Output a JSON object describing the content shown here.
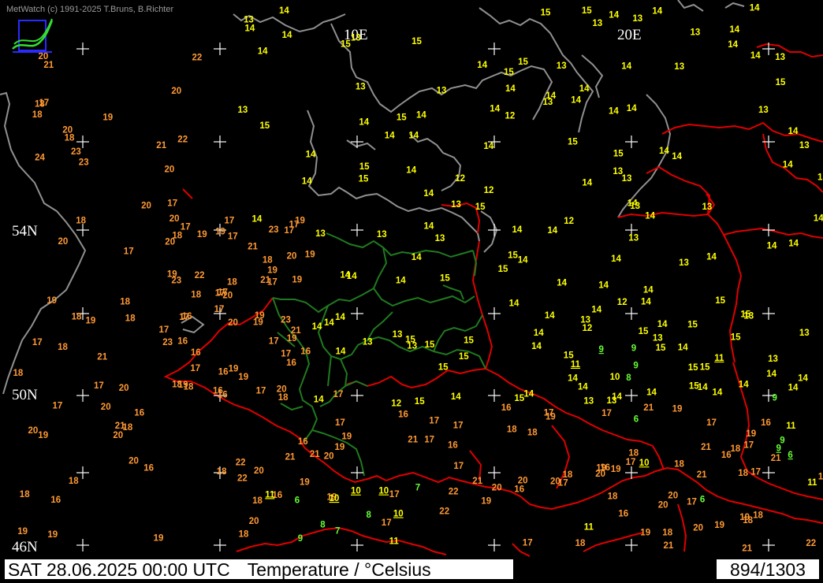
{
  "header": {
    "credit": "MetWatch  (c) 1991-2025 T.Bruns, B.Richter"
  },
  "logo": {
    "icon": "metwatch-logo-icon"
  },
  "footer": {
    "datetime": "SAT 28.06.2025 00:00 UTC",
    "parameter": "Temperature / °Celsius",
    "counter": "894/1303"
  },
  "map": {
    "lat_labels": [
      "54N",
      "50N",
      "46N"
    ],
    "lon_labels": [
      "10E",
      "20E"
    ],
    "colors": {
      "background": "#000000",
      "coast": "#909090",
      "border": "#e00000",
      "state": "#1f7a1f",
      "temp_le9": "#66ff33",
      "temp_10_15": "#ffff00",
      "temp_16_plus": "#ff9933",
      "grid": "#ffffff"
    },
    "stations": [
      [
        15,
        "15"
      ],
      [
        15,
        "15"
      ],
      [
        16,
        "16"
      ],
      [
        16,
        "16"
      ],
      [
        16,
        "16"
      ],
      [
        15,
        "15"
      ],
      [
        16,
        "16"
      ],
      [
        17,
        "17"
      ],
      [
        16,
        "16"
      ],
      [
        16,
        "16"
      ],
      [
        18,
        "18"
      ],
      [
        17,
        "17"
      ],
      [
        16,
        "16"
      ],
      [
        17,
        "17"
      ],
      [
        17,
        "17"
      ],
      [
        17,
        "17"
      ],
      [
        16,
        "16"
      ],
      [
        18,
        "18"
      ],
      [
        17,
        "17"
      ],
      [
        9,
        "9"
      ],
      [
        16,
        "16"
      ],
      [
        18,
        "18"
      ],
      [
        17,
        "17"
      ],
      [
        19,
        "19"
      ],
      [
        17,
        "17"
      ],
      [
        18,
        "18"
      ],
      [
        16,
        "16"
      ],
      [
        20,
        "20"
      ],
      [
        19,
        "19"
      ],
      [
        21,
        "21"
      ],
      [
        21,
        "21"
      ],
      [
        19,
        "19"
      ],
      [
        18,
        "18"
      ],
      [
        20,
        "20"
      ],
      [
        22,
        "22"
      ],
      [
        21,
        "21"
      ],
      [
        20,
        "20"
      ],
      [
        19,
        "19"
      ],
      [
        18,
        "18"
      ],
      [
        21,
        "21"
      ],
      [
        21,
        "21"
      ],
      [
        20,
        "20"
      ],
      [
        19,
        "19"
      ],
      [
        17,
        "17"
      ],
      [
        18,
        "18"
      ],
      [
        20,
        "20"
      ],
      [
        21,
        "21"
      ],
      [
        22,
        "22"
      ],
      [
        21,
        "21"
      ],
      [
        20,
        "20"
      ],
      [
        18,
        "18"
      ],
      [
        19,
        "19"
      ],
      [
        17,
        "17"
      ],
      [
        18,
        "18"
      ],
      [
        17,
        "17"
      ],
      [
        19,
        "19"
      ],
      [
        20,
        "20"
      ],
      [
        18,
        "18"
      ],
      [
        19,
        "19"
      ],
      [
        18,
        "18"
      ],
      [
        19,
        "19"
      ],
      [
        20,
        "20"
      ],
      [
        18,
        "18"
      ],
      [
        16,
        "16"
      ],
      [
        17,
        "17"
      ],
      [
        18,
        "18"
      ],
      [
        19,
        "19"
      ],
      [
        20,
        "20"
      ],
      [
        19,
        "19"
      ],
      [
        18,
        "18"
      ],
      [
        17,
        "17"
      ],
      [
        16,
        "16"
      ],
      [
        17,
        "17"
      ],
      [
        18,
        "18"
      ],
      [
        16,
        "16"
      ],
      [
        18,
        "18"
      ],
      [
        17,
        "17"
      ],
      [
        20,
        "20"
      ],
      [
        19,
        "19"
      ],
      [
        18,
        "18"
      ],
      [
        17,
        "17"
      ],
      [
        19,
        "19"
      ],
      [
        18,
        "18"
      ],
      [
        17,
        "17"
      ],
      [
        16,
        "16"
      ],
      [
        17,
        "17"
      ],
      [
        18,
        "18"
      ],
      [
        20,
        "20"
      ],
      [
        18,
        "18"
      ],
      [
        19,
        "19"
      ],
      [
        17,
        "17"
      ],
      [
        18,
        "18"
      ],
      [
        19,
        "19"
      ],
      [
        17,
        "17"
      ],
      [
        16,
        "16"
      ],
      [
        17,
        "17"
      ],
      [
        17,
        "17"
      ],
      [
        18,
        "18"
      ],
      [
        19,
        "19"
      ],
      [
        20,
        "20"
      ],
      [
        21,
        "21"
      ],
      [
        20,
        "20"
      ],
      [
        19,
        "19"
      ],
      [
        20,
        "20"
      ],
      [
        18,
        "18"
      ],
      [
        20,
        "20"
      ],
      [
        21,
        "21"
      ],
      [
        19,
        "19"
      ],
      [
        17,
        "17"
      ],
      [
        20,
        "20"
      ],
      [
        18,
        "18"
      ],
      [
        23,
        "23"
      ],
      [
        19,
        "19"
      ],
      [
        17,
        "17"
      ],
      [
        18,
        "18"
      ],
      [
        19,
        "19"
      ],
      [
        16,
        "16"
      ],
      [
        18,
        "18"
      ],
      [
        19,
        "19"
      ],
      [
        17,
        "17"
      ],
      [
        16,
        "16"
      ],
      [
        20,
        "20"
      ],
      [
        21,
        "21"
      ],
      [
        17,
        "17"
      ],
      [
        19,
        "19"
      ],
      [
        20,
        "20"
      ],
      [
        18,
        "18"
      ],
      [
        17,
        "17"
      ],
      [
        19,
        "19"
      ],
      [
        16,
        "16"
      ],
      [
        17,
        "17"
      ],
      [
        20,
        "20"
      ],
      [
        21,
        "21"
      ],
      [
        19,
        "19"
      ],
      [
        17,
        "17"
      ],
      [
        18,
        "18"
      ],
      [
        23,
        "23"
      ],
      [
        22,
        "22"
      ],
      [
        19,
        "19"
      ],
      [
        20,
        "20"
      ],
      [
        21,
        "21"
      ],
      [
        17,
        "17"
      ],
      [
        19,
        "19"
      ],
      [
        16,
        "16"
      ],
      [
        17,
        "17"
      ],
      [
        23,
        "23"
      ],
      [
        22,
        "22"
      ],
      [
        18,
        "18"
      ],
      [
        17,
        "17"
      ],
      [
        19,
        "19"
      ],
      [
        20,
        "20"
      ],
      [
        21,
        "21"
      ],
      [
        17,
        "17"
      ],
      [
        18,
        "18"
      ],
      [
        19,
        "19"
      ],
      [
        17,
        "17"
      ],
      [
        22,
        "22"
      ],
      [
        23,
        "23"
      ],
      [
        20,
        "20"
      ],
      [
        19,
        "19"
      ],
      [
        17,
        "17"
      ],
      [
        18,
        "18"
      ],
      [
        16,
        "16"
      ],
      [
        19,
        "19"
      ],
      [
        20,
        "20"
      ],
      [
        21,
        "21"
      ],
      [
        22,
        "22"
      ],
      [
        23,
        "23"
      ],
      [
        24,
        "24"
      ],
      [
        18,
        "18"
      ],
      [
        17,
        "17"
      ],
      [
        19,
        "19"
      ],
      [
        20,
        "20"
      ],
      [
        21,
        "21"
      ],
      [
        22,
        "22"
      ],
      [
        23,
        "23"
      ],
      [
        18,
        "18"
      ],
      [
        17,
        "17"
      ],
      [
        16,
        "16"
      ],
      [
        19,
        "19"
      ],
      [
        20,
        "20"
      ],
      [
        21,
        "21"
      ],
      [
        22,
        "22"
      ],
      [
        20,
        "20"
      ],
      [
        19,
        "19"
      ],
      [
        18,
        "18"
      ],
      [
        17,
        "17"
      ],
      [
        19,
        "19"
      ],
      [
        20,
        "20"
      ],
      [
        21,
        "21"
      ],
      [
        14,
        "14"
      ],
      [
        14,
        "14"
      ],
      [
        14,
        "14"
      ],
      [
        15,
        "15"
      ],
      [
        14,
        "14"
      ],
      [
        14,
        "14"
      ],
      [
        14,
        "14"
      ],
      [
        14,
        "14"
      ],
      [
        14,
        "14"
      ],
      [
        13,
        "13"
      ],
      [
        14,
        "14"
      ],
      [
        13,
        "13"
      ],
      [
        13,
        "13"
      ],
      [
        14,
        "14"
      ],
      [
        14,
        "14"
      ],
      [
        13,
        "13"
      ],
      [
        12,
        "12"
      ],
      [
        14,
        "14"
      ],
      [
        13,
        "13"
      ],
      [
        15,
        "15"
      ],
      [
        14,
        "14"
      ],
      [
        12,
        "12"
      ],
      [
        13,
        "13"
      ],
      [
        14,
        "14"
      ],
      [
        14,
        "14"
      ],
      [
        13,
        "13"
      ],
      [
        15,
        "15"
      ],
      [
        13,
        "13"
      ],
      [
        12,
        "12"
      ],
      [
        13,
        "13"
      ],
      [
        15,
        "15"
      ],
      [
        13,
        "13"
      ],
      [
        15,
        "15"
      ],
      [
        14,
        "14"
      ],
      [
        15,
        "15"
      ],
      [
        14,
        "14"
      ],
      [
        14,
        "14"
      ],
      [
        14,
        "14"
      ],
      [
        14,
        "14"
      ],
      [
        15,
        "15"
      ],
      [
        14,
        "14"
      ],
      [
        14,
        "14"
      ],
      [
        14,
        "14"
      ],
      [
        13,
        "13"
      ],
      [
        15,
        "15"
      ],
      [
        14,
        "14"
      ],
      [
        14,
        "14"
      ],
      [
        15,
        "15"
      ],
      [
        14,
        "14"
      ],
      [
        15,
        "15"
      ],
      [
        14,
        "14"
      ],
      [
        14,
        "14"
      ],
      [
        14,
        "14"
      ],
      [
        14,
        "14"
      ],
      [
        13,
        "13"
      ],
      [
        12,
        "12"
      ],
      [
        15,
        "15"
      ],
      [
        14,
        "14"
      ],
      [
        14,
        "14"
      ],
      [
        13,
        "13"
      ],
      [
        14,
        "14"
      ],
      [
        14,
        "14"
      ],
      [
        15,
        "15"
      ],
      [
        14,
        "14"
      ],
      [
        13,
        "13"
      ],
      [
        14,
        "14"
      ],
      [
        14,
        "14"
      ],
      [
        15,
        "15"
      ],
      [
        14,
        "14"
      ],
      [
        14,
        "14"
      ],
      [
        15,
        "15"
      ],
      [
        13,
        "13"
      ],
      [
        14,
        "14"
      ],
      [
        13,
        "13"
      ],
      [
        13,
        "13"
      ],
      [
        14,
        "14"
      ],
      [
        13,
        "13"
      ],
      [
        14,
        "14"
      ],
      [
        13,
        "13"
      ],
      [
        14,
        "14"
      ],
      [
        15,
        "15"
      ],
      [
        13,
        "13"
      ],
      [
        14,
        "14"
      ],
      [
        14,
        "14"
      ],
      [
        12,
        "12"
      ],
      [
        14,
        "14"
      ],
      [
        14,
        "14"
      ],
      [
        13,
        "13"
      ],
      [
        14,
        "14"
      ],
      [
        15,
        "15"
      ],
      [
        14,
        "14"
      ],
      [
        13,
        "13"
      ],
      [
        14,
        "14"
      ],
      [
        15,
        "15"
      ],
      [
        14,
        "14"
      ],
      [
        14,
        "14"
      ],
      [
        14,
        "14"
      ],
      [
        15,
        "15"
      ],
      [
        13,
        "13"
      ],
      [
        14,
        "14"
      ],
      [
        14,
        "14"
      ],
      [
        15,
        "15"
      ],
      [
        14,
        "14"
      ],
      [
        13,
        "13"
      ],
      [
        14,
        "14"
      ],
      [
        15,
        "15"
      ],
      [
        14,
        "14"
      ],
      [
        13,
        "13"
      ],
      [
        14,
        "14"
      ],
      [
        15,
        "15"
      ],
      [
        13,
        "13"
      ],
      [
        15,
        "15"
      ],
      [
        14,
        "14"
      ],
      [
        13,
        "13"
      ],
      [
        14,
        "14"
      ],
      [
        15,
        "15"
      ],
      [
        14,
        "14"
      ],
      [
        14,
        "14"
      ],
      [
        13,
        "13"
      ],
      [
        14,
        "14"
      ],
      [
        14,
        "14"
      ],
      [
        15,
        "15"
      ],
      [
        13,
        "13"
      ],
      [
        14,
        "14"
      ],
      [
        15,
        "15"
      ],
      [
        12,
        "12"
      ],
      [
        14,
        "14"
      ],
      [
        15,
        "15"
      ],
      [
        13,
        "13"
      ],
      [
        14,
        "14"
      ],
      [
        15,
        "15"
      ],
      [
        15,
        "15"
      ],
      [
        14,
        "14"
      ],
      [
        13,
        "13"
      ],
      [
        14,
        "14"
      ],
      [
        14,
        "14"
      ],
      [
        15,
        "15"
      ],
      [
        14,
        "14"
      ],
      [
        13,
        "13"
      ],
      [
        13,
        "13"
      ],
      [
        14,
        "14"
      ],
      [
        15,
        "15"
      ],
      [
        14,
        "14"
      ],
      [
        12,
        "12"
      ],
      [
        14,
        "14"
      ],
      [
        15,
        "15"
      ],
      [
        14,
        "14"
      ],
      [
        15,
        "15"
      ],
      [
        13,
        "13"
      ],
      [
        14,
        "14"
      ],
      [
        9,
        "9"
      ],
      [
        6,
        "6"
      ],
      [
        9,
        "9"
      ],
      [
        6,
        "6"
      ],
      [
        8,
        "8"
      ],
      [
        10,
        "10"
      ],
      [
        11,
        "11"
      ],
      [
        9,
        "9"
      ],
      [
        7,
        "7"
      ],
      [
        6,
        "6"
      ],
      [
        10,
        "10"
      ],
      [
        11,
        "11"
      ],
      [
        11,
        "11"
      ],
      [
        10,
        "10"
      ],
      [
        9,
        "9"
      ],
      [
        11,
        "11"
      ],
      [
        6,
        "6"
      ],
      [
        8,
        "8"
      ],
      [
        11,
        "11"
      ],
      [
        11,
        "11"
      ],
      [
        10,
        "10"
      ],
      [
        9,
        "9"
      ],
      [
        10,
        "10"
      ],
      [
        7,
        "7"
      ],
      [
        11,
        "11"
      ],
      [
        8,
        "8"
      ],
      [
        9,
        "9"
      ],
      [
        10,
        "10"
      ]
    ]
  }
}
